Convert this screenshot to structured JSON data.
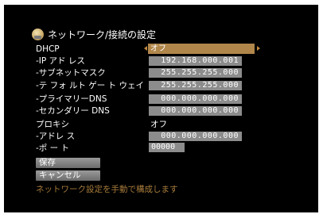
{
  "title": "ネットワーク/接続の設定",
  "dhcp": {
    "label": "DHCP",
    "value": "オフ"
  },
  "ip_address": {
    "label": "-IP アド レス",
    "value": "192.168.000.001"
  },
  "subnet_mask": {
    "label": "-サブネットマスク",
    "value": "255.255.255.000"
  },
  "default_gateway": {
    "label": "-テ フォ ルト ゲー ト ウェイ",
    "value": "255.255.255.000"
  },
  "primary_dns": {
    "label": "-プライマリーDNS",
    "value": "000.000.000.000"
  },
  "secondary_dns": {
    "label": "-セカンダリー DNS",
    "value": "000.000.000.000"
  },
  "proxy": {
    "label": "プロキシ",
    "value": "オフ"
  },
  "proxy_address": {
    "label": "-アドレ ス",
    "value": "000.000.000.000"
  },
  "port": {
    "label": "-ポ ー ト",
    "value": "00000"
  },
  "buttons": {
    "save": "保存",
    "cancel": "キャンセル"
  },
  "hint": "ネットワーク設定を手動で構成します",
  "colors": {
    "accent": "#b0864a",
    "field": "#8c8c8c",
    "hint": "#a77b3b",
    "background": "#000000"
  }
}
